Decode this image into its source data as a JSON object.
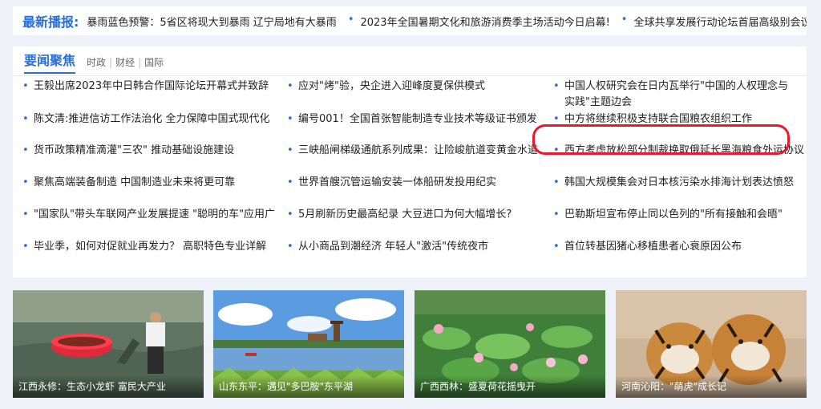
{
  "ticker": {
    "label": "最新播报:",
    "items": [
      "暴雨蓝色预警：5省区将现大到暴雨 辽宁局地有大暴雨",
      "2023年全国暑期文化和旅游消费季主场活动今日启幕!",
      "全球共享发展行动论坛首届高级别会议将在"
    ]
  },
  "news": {
    "title": "要闻聚焦",
    "tags": [
      "时政",
      "财经",
      "国际"
    ],
    "col1": [
      "王毅出席2023年中日韩合作国际论坛开幕式并致辞",
      "陈文清:推进信访工作法治化 全力保障中国式现代化",
      "货币政策精准滴灌\"三农\" 推动基础设施建设",
      "聚焦高端装备制造 中国制造业未来将更可靠",
      "\"国家队\"带头车联网产业发展提速 \"聪明的车\"应用广",
      "毕业季，如何对促就业再发力？ 高职特色专业详解"
    ],
    "col2": [
      "应对\"烤\"验，央企进入迎峰度夏保供模式",
      "编号001！全国首张智能制造专业技术等级证书颁发",
      "三峡船闸梯级通航系列成果：让险峻航道变黄金水道",
      "世界首艘沉管运输安装一体船研发投用纪实",
      "5月刷新历史最高纪录 大豆进口为何大幅增长?",
      "从小商品到潮经济 年轻人\"激活\"传统夜市"
    ],
    "col3": [
      "中国人权研究会在日内瓦举行\"中国的人权理念与实践\"主题边会",
      "中方将继续积极支持联合国粮农组织工作",
      "西方考虑放松部分制裁换取俄延长黑海粮食外运协议",
      "韩国大规模集会对日本核污染水排海计划表达愤怒",
      "巴勒斯坦宣布停止同以色列的\"所有接触和会晤\"",
      "首位转基因猪心移植患者心衰原因公布"
    ]
  },
  "cards": [
    {
      "caption": "江西永修：生态小龙虾 富民大产业"
    },
    {
      "caption": "山东东平：遇见\"多巴胺\"东平湖"
    },
    {
      "caption": "广西西林：盛夏荷花摇曳开"
    },
    {
      "caption": "河南沁阳：\"萌虎\"成长记"
    }
  ],
  "colors": {
    "accent": "#2b6fd6",
    "highlight": "#e8192c"
  }
}
